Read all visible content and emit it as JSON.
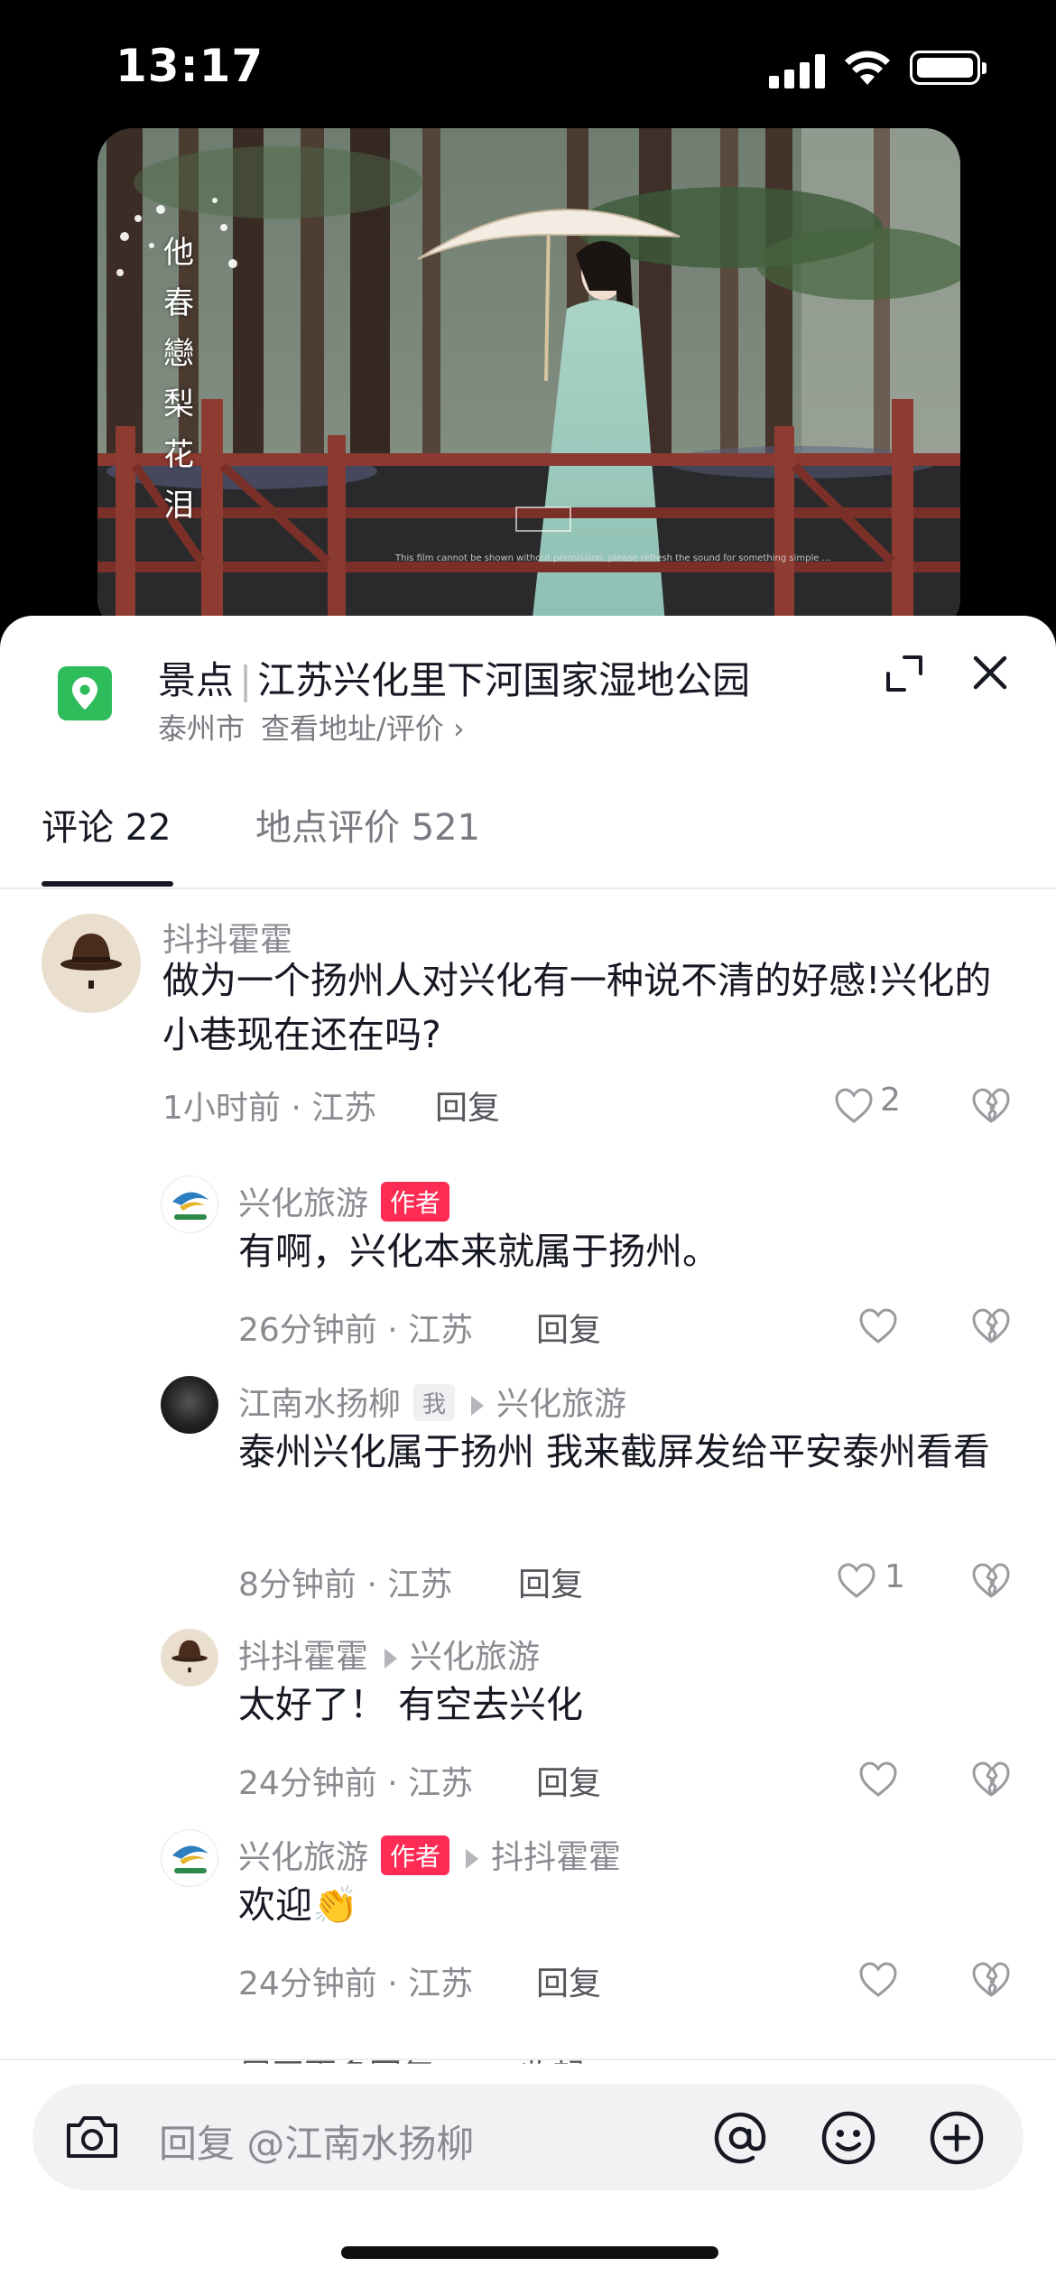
{
  "status_bar": {
    "time": "13:17"
  },
  "video": {
    "vertical_title": [
      "他",
      "春",
      "戀",
      "梨",
      "花",
      "泪"
    ],
    "caption": "This film cannot be shown without permission, please refresh the sound for something simple ..."
  },
  "poi": {
    "category": "景点",
    "name": "江苏兴化里下河国家湿地公园",
    "city": "泰州市",
    "link": "查看地址/评价",
    "link_arrow": "›"
  },
  "tabs": [
    {
      "label": "评论 22",
      "active": true
    },
    {
      "label": "地点评价 521",
      "active": false
    }
  ],
  "comments": [
    {
      "user": "抖抖霍霍",
      "text": "做为一个扬州人对兴化有一种说不清的好感!兴化的小巷现在还在吗?",
      "meta": "1小时前 · 江苏",
      "reply": "回复",
      "likes": "2"
    },
    {
      "user": "兴化旅游",
      "badge": "作者",
      "text": "有啊，兴化本来就属于扬州。",
      "meta": "26分钟前 · 江苏",
      "reply": "回复",
      "likes": ""
    },
    {
      "user": "江南水扬柳",
      "badge": "我",
      "reply_to": "兴化旅游",
      "text": "泰州兴化属于扬州 我来截屏发给平安泰州看看",
      "meta": "8分钟前 · 江苏",
      "reply": "回复",
      "likes": "1"
    },
    {
      "user": "抖抖霍霍",
      "reply_to": "兴化旅游",
      "text": "太好了！ 有空去兴化",
      "meta": "24分钟前 · 江苏",
      "reply": "回复",
      "likes": ""
    },
    {
      "user": "兴化旅游",
      "badge": "作者",
      "reply_to": "抖抖霍霍",
      "text": "欢迎👏",
      "meta": "24分钟前 · 江苏",
      "reply": "回复",
      "likes": ""
    }
  ],
  "more_peek": "展开更多回复 —— 收起",
  "input": {
    "placeholder": "回复 @江南水扬柳"
  },
  "colors": {
    "accent": "#fe2c55",
    "poi_green": "#2fbd5b"
  },
  "icons": [
    "camera-icon",
    "at-icon",
    "emoji-icon",
    "plus-icon",
    "like-heart-icon",
    "dislike-broken-heart-icon",
    "expand-icon",
    "close-icon",
    "location-pin-icon"
  ]
}
